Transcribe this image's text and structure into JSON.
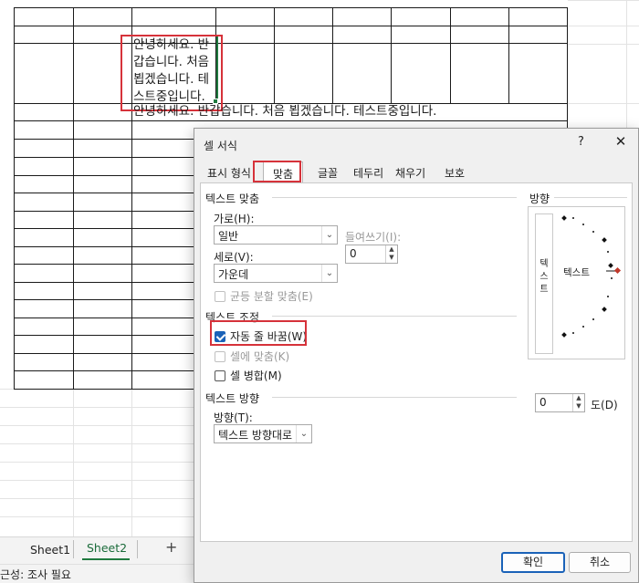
{
  "sheet": {
    "wrapped_lines": [
      "안녕하세요. 반",
      "갑습니다. 처음",
      "뵙겠습니다. 테",
      "스트중입니다."
    ],
    "overflow_text": "안녕하세요. 반갑습니다. 처음 뵙겠습니다. 테스트중입니다."
  },
  "sheet_tabs": {
    "tab1": "Sheet1",
    "tab2": "Sheet2",
    "add": "+"
  },
  "status": {
    "text": "근성: 조사 필요"
  },
  "dialog": {
    "title": "셀 서식",
    "help": "?",
    "close": "✕",
    "tabs": [
      "표시 형식",
      "맞춤",
      "글꼴",
      "테두리",
      "채우기",
      "보호"
    ],
    "active_tab": "맞춤",
    "text_align": {
      "group": "텍스트 맞춤",
      "horizontal_label": "가로(H):",
      "horizontal_value": "일반",
      "indent_label": "들여쓰기(I):",
      "indent_value": "0",
      "vertical_label": "세로(V):",
      "vertical_value": "가운데",
      "distributed_label": "균등 분할 맞춤(E)"
    },
    "text_control": {
      "group": "텍스트 조정",
      "wrap_label": "자동 줄 바꿈(W)",
      "wrap_checked": true,
      "shrink_label": "셀에 맞춤(K)",
      "merge_label": "셀 병합(M)"
    },
    "direction": {
      "group": "텍스트 방향",
      "label": "방향(T):",
      "value": "텍스트 방향대로"
    },
    "orientation": {
      "group": "방향",
      "vertical_text": [
        "텍",
        "스",
        "트"
      ],
      "horizontal_text": "텍스트",
      "degrees_value": "0",
      "degrees_label": "도(D)"
    },
    "ok_label": "확인",
    "cancel_label": "취소"
  },
  "colors": {
    "highlight": "#d6323a",
    "accent": "#1a62b8",
    "selection": "#1f7a3f"
  }
}
